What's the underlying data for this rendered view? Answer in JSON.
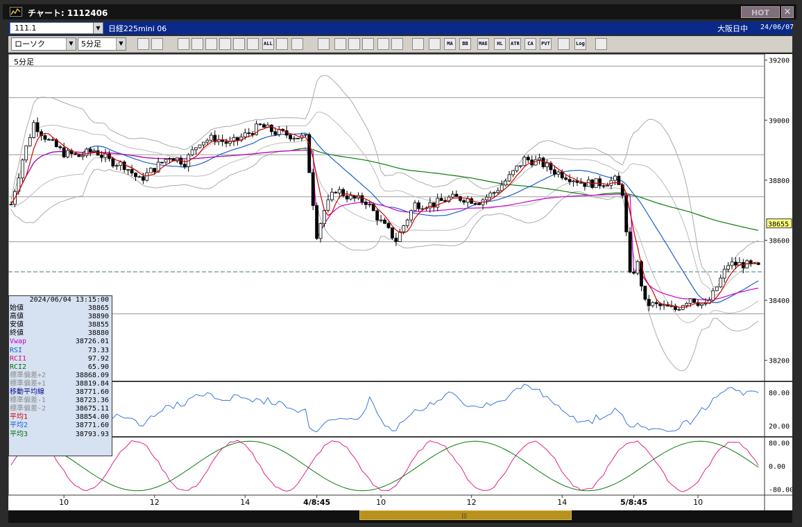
{
  "window": {
    "title": "チャート: 1112406",
    "hot_button": "HOT",
    "close_glyph": "✕"
  },
  "info_bar": {
    "symbol_code": "111.1",
    "symbol_name": "日経225mini 06",
    "market": "大阪日中",
    "date": "24/06/07"
  },
  "toolbar": {
    "chart_type": "ローソク",
    "timeframe": "5分足",
    "buttons": [
      "zoom-icon",
      "split-icon",
      "download-icon",
      "search-stats-icon",
      "bidask-icon",
      "grey-icon",
      "candle-a-icon",
      "candle-b-icon",
      "all-icon",
      "line-tool-icon",
      "pencil-icon",
      "cursor-icon",
      "note-icon",
      "doc-icon",
      "trash-icon",
      "pattern-icon",
      "brush-icon",
      "color-icon",
      "ind-icon",
      "ma-icon",
      "bb-icon",
      "mae-icon",
      "hl-icon",
      "atr-icon",
      "ca-icon",
      "pvt-icon",
      "box-icon",
      "log-icon",
      "export-icon"
    ],
    "button_texts": {
      "all-icon": "ALL",
      "ma-icon": "MA",
      "bb-icon": "BB",
      "mae-icon": "MAE",
      "hl-icon": "HL",
      "atr-icon": "ATR",
      "ca-icon": "CA",
      "pvt-icon": "PVT",
      "log-icon": "Log"
    }
  },
  "info_box": {
    "datetime": "2024/06/04  13:15:00",
    "rows": [
      {
        "label": "始値",
        "value": "38865",
        "color": "#000000"
      },
      {
        "label": "高値",
        "value": "38890",
        "color": "#000000"
      },
      {
        "label": "安値",
        "value": "38855",
        "color": "#000000"
      },
      {
        "label": "終値",
        "value": "38880",
        "color": "#000000"
      },
      {
        "label": "Vwap",
        "value": "38726.01",
        "color": "#c800c8"
      },
      {
        "label": "RSI",
        "value": "73.33",
        "color": "#1a5fc8"
      },
      {
        "label": "RCI1",
        "value": "97.92",
        "color": "#c8147a"
      },
      {
        "label": "RCI2",
        "value": "65.90",
        "color": "#0a6a0a"
      },
      {
        "label": "標準偏差+2",
        "value": "38868.09",
        "color": "#8c8c8c"
      },
      {
        "label": "標準偏差+1",
        "value": "38819.84",
        "color": "#8c8c8c"
      },
      {
        "label": "移動平均線",
        "value": "38771.60",
        "color": "#0a0a8a"
      },
      {
        "label": "標準偏差-1",
        "value": "38723.36",
        "color": "#8c8c8c"
      },
      {
        "label": "標準偏差-2",
        "value": "38675.11",
        "color": "#8c8c8c"
      },
      {
        "label": "平均1",
        "value": "38854.00",
        "color": "#d00000"
      },
      {
        "label": "平均2",
        "value": "38771.60",
        "color": "#1a5fc8"
      },
      {
        "label": "平均3",
        "value": "38793.93",
        "color": "#0a6a0a"
      }
    ]
  },
  "chart_data": {
    "type": "candlestick",
    "timeframe_label": "5分足",
    "current_price_label": "38655",
    "price_axis": {
      "ticks": [
        38200,
        38400,
        38600,
        38800,
        39000,
        39200
      ],
      "range": [
        38130,
        39220
      ]
    },
    "rsi_axis": {
      "ticks": [
        "80.00",
        "20.00"
      ],
      "range": [
        0,
        100
      ]
    },
    "rci_axis": {
      "ticks": [
        "80.00",
        "0.00",
        "-80.00"
      ],
      "range": [
        -100,
        100
      ]
    },
    "x_ticks": [
      {
        "label": "10",
        "bar": 14,
        "bold": false
      },
      {
        "label": "12",
        "bar": 38,
        "bold": false
      },
      {
        "label": "14",
        "bar": 62,
        "bold": false
      },
      {
        "label": "4/8:45",
        "bar": 81,
        "bold": true
      },
      {
        "label": "10",
        "bar": 98,
        "bold": false
      },
      {
        "label": "12",
        "bar": 122,
        "bold": false
      },
      {
        "label": "14",
        "bar": 146,
        "bold": false
      },
      {
        "label": "5/8:45",
        "bar": 165,
        "bold": true
      },
      {
        "label": "10",
        "bar": 182,
        "bold": false
      }
    ],
    "horizontal_levels": [
      39180,
      39075,
      38885,
      38745,
      38595,
      38355
    ],
    "dashed_level": 38495,
    "price_path": [
      [
        0,
        38720
      ],
      [
        3,
        38870
      ],
      [
        6,
        38990
      ],
      [
        10,
        38930
      ],
      [
        14,
        38890
      ],
      [
        18,
        38880
      ],
      [
        22,
        38900
      ],
      [
        26,
        38865
      ],
      [
        30,
        38850
      ],
      [
        34,
        38800
      ],
      [
        38,
        38840
      ],
      [
        42,
        38880
      ],
      [
        46,
        38860
      ],
      [
        50,
        38930
      ],
      [
        54,
        38940
      ],
      [
        58,
        38920
      ],
      [
        62,
        38950
      ],
      [
        66,
        38980
      ],
      [
        70,
        38960
      ],
      [
        74,
        38950
      ],
      [
        78,
        38940
      ],
      [
        81,
        38620
      ],
      [
        83,
        38700
      ],
      [
        86,
        38770
      ],
      [
        90,
        38740
      ],
      [
        94,
        38730
      ],
      [
        98,
        38660
      ],
      [
        102,
        38600
      ],
      [
        104,
        38650
      ],
      [
        107,
        38720
      ],
      [
        112,
        38720
      ],
      [
        116,
        38740
      ],
      [
        120,
        38740
      ],
      [
        124,
        38730
      ],
      [
        128,
        38760
      ],
      [
        132,
        38810
      ],
      [
        136,
        38870
      ],
      [
        140,
        38860
      ],
      [
        144,
        38830
      ],
      [
        148,
        38810
      ],
      [
        152,
        38790
      ],
      [
        156,
        38790
      ],
      [
        160,
        38800
      ],
      [
        162,
        38760
      ],
      [
        164,
        38480
      ],
      [
        166,
        38520
      ],
      [
        168,
        38390
      ],
      [
        172,
        38380
      ],
      [
        176,
        38370
      ],
      [
        180,
        38410
      ],
      [
        184,
        38380
      ],
      [
        186,
        38420
      ],
      [
        190,
        38520
      ],
      [
        194,
        38520
      ],
      [
        198,
        38510
      ]
    ]
  }
}
